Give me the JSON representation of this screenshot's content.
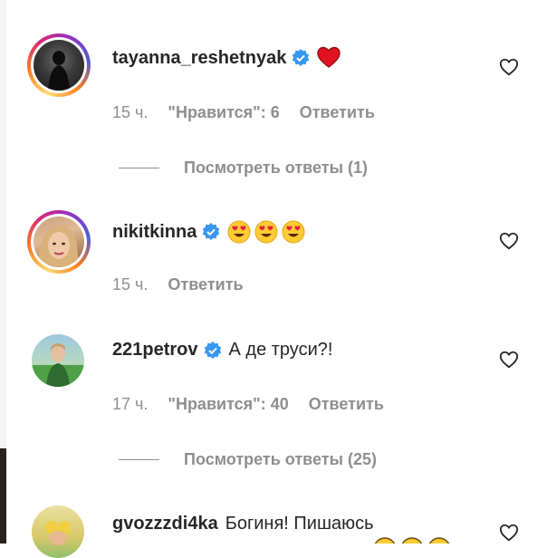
{
  "comments": [
    {
      "username": "tayanna_reshetnyak",
      "text": "",
      "time": "15 ч.",
      "likes": "\"Нравится\": 6",
      "reply": "Ответить",
      "view_replies": "Посмотреть ответы (1)",
      "emoji": [
        "heart"
      ],
      "story_ring": true
    },
    {
      "username": "nikitkinna",
      "text": "",
      "time": "15 ч.",
      "likes": "",
      "reply": "Ответить",
      "emoji": [
        "heart-eyes",
        "heart-eyes",
        "heart-eyes"
      ],
      "story_ring": true
    },
    {
      "username": "221petrov",
      "text": "А де труси?!",
      "time": "17 ч.",
      "likes": "\"Нравится\": 40",
      "reply": "Ответить",
      "view_replies": "Посмотреть ответы (25)",
      "story_ring": false
    },
    {
      "username": "gvozzzdi4ka",
      "text": "Богиня! Пишаюсь",
      "story_ring": false
    }
  ],
  "colors": {
    "verified": "#3897f0",
    "text": "#262626",
    "secondary": "#8e8e8e",
    "heart": "#ed4956"
  }
}
